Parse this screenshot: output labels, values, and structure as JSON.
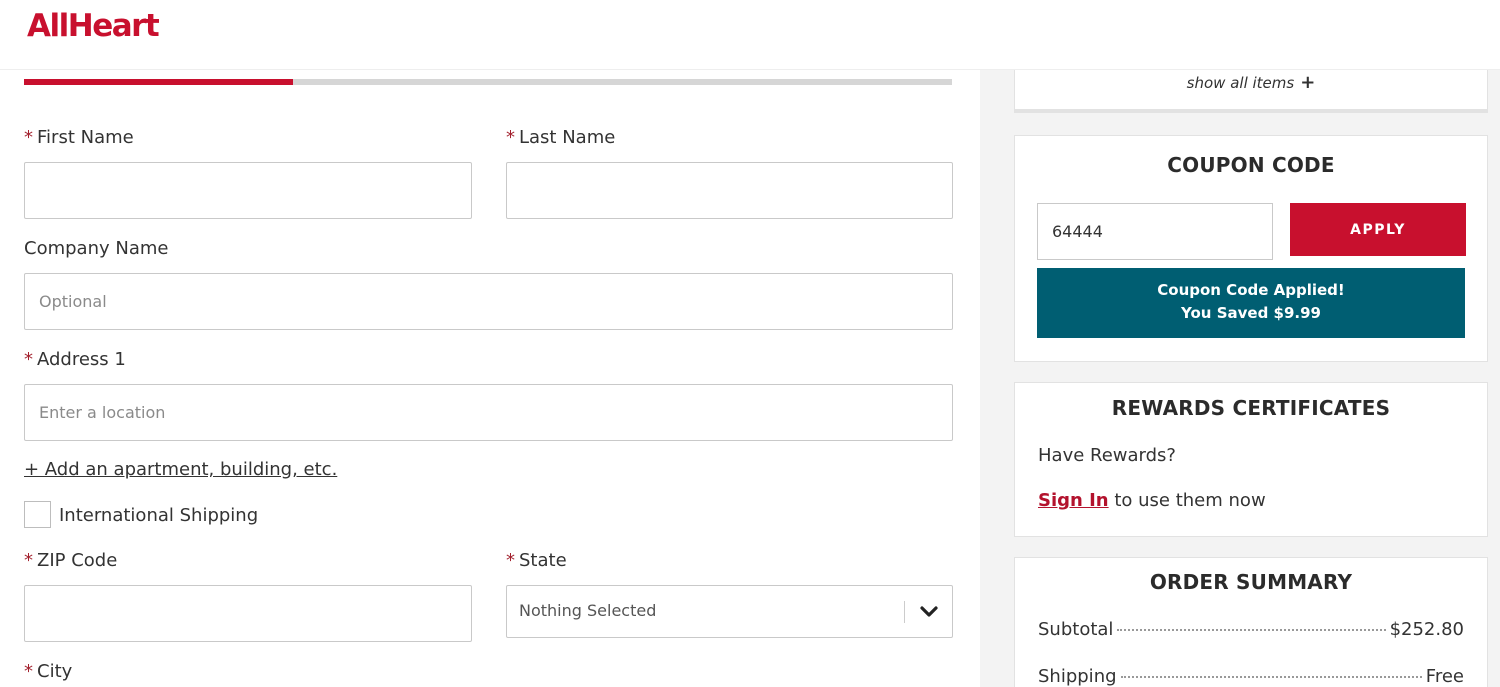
{
  "brand": {
    "logo_text": "AllHeart",
    "color": "#c8102e"
  },
  "progress": {
    "fraction": 0.29
  },
  "form": {
    "first_name": {
      "label": "First Name",
      "value": ""
    },
    "last_name": {
      "label": "Last Name",
      "value": ""
    },
    "company": {
      "label": "Company Name",
      "placeholder": "Optional"
    },
    "address1": {
      "label": "Address 1",
      "placeholder": "Enter a location"
    },
    "add_apartment_link": "+ Add an apartment, building, etc.",
    "international": {
      "label": "International Shipping",
      "checked": false
    },
    "zip": {
      "label": "ZIP Code",
      "value": ""
    },
    "state": {
      "label": "State",
      "selected": "Nothing Selected"
    },
    "city": {
      "label": "City"
    },
    "required_marker": "*"
  },
  "sidebar": {
    "show_all_items": "show all items",
    "show_all_icon": "+",
    "coupon": {
      "title": "COUPON CODE",
      "value": "64444",
      "apply_label": "APPLY",
      "applied_line1": "Coupon Code Applied!",
      "applied_line2": "You Saved $9.99",
      "banner_color": "#005e72"
    },
    "rewards": {
      "title": "REWARDS CERTIFICATES",
      "question": "Have Rewards?",
      "signin_label": "Sign In",
      "signin_suffix": " to use them now"
    },
    "summary": {
      "title": "ORDER SUMMARY",
      "rows": [
        {
          "label": "Subtotal",
          "value": "$252.80"
        },
        {
          "label": "Shipping",
          "value": "Free"
        }
      ]
    }
  }
}
